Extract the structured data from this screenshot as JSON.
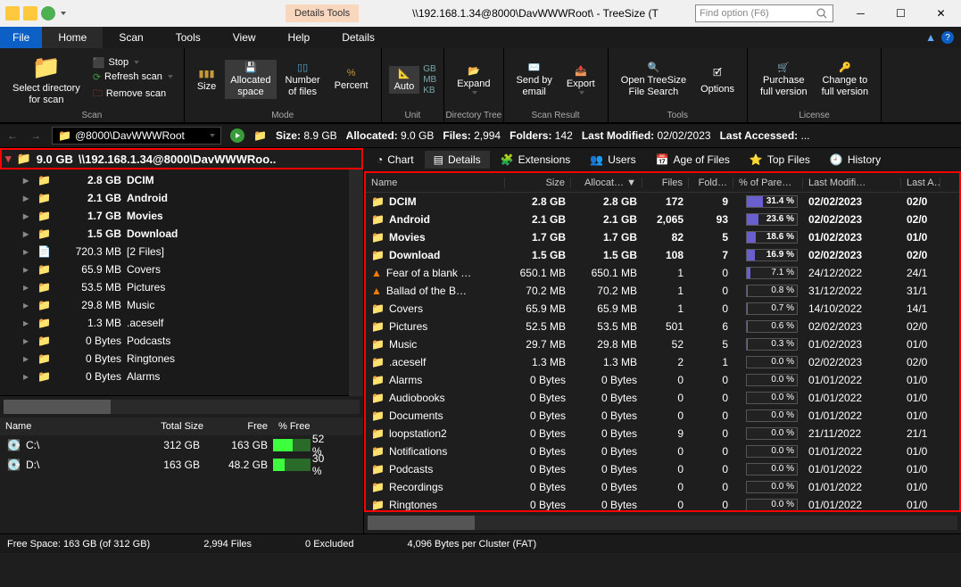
{
  "titlebar": {
    "details_tools": "Details Tools",
    "title": "\\\\192.168.1.34@8000\\DavWWWRoot\\ - TreeSize (T",
    "search_placeholder": "Find option (F6)"
  },
  "menu": {
    "file": "File",
    "home": "Home",
    "scan": "Scan",
    "tools": "Tools",
    "view": "View",
    "help": "Help",
    "details": "Details"
  },
  "ribbon": {
    "select_dir": "Select directory\nfor scan",
    "stop": "Stop",
    "refresh": "Refresh scan",
    "remove": "Remove scan",
    "scan_label": "Scan",
    "size": "Size",
    "allocated": "Allocated\nspace",
    "numfiles": "Number\nof files",
    "percent": "Percent",
    "mode_label": "Mode",
    "auto": "Auto",
    "gb": "GB",
    "mb": "MB",
    "kb": "KB",
    "unit_label": "Unit",
    "expand": "Expand",
    "dirtree_label": "Directory Tree",
    "sendby": "Send by\nemail",
    "export": "Export",
    "scanres_label": "Scan Result",
    "open_ts": "Open TreeSize\nFile Search",
    "options": "Options",
    "tools_label": "Tools",
    "purchase": "Purchase\nfull version",
    "change": "Change to\nfull version",
    "license_label": "License"
  },
  "pathbar": {
    "path": "@8000\\DavWWWRoot",
    "size_label": "Size:",
    "size_val": "8.9 GB",
    "alloc_label": "Allocated:",
    "alloc_val": "9.0 GB",
    "files_label": "Files:",
    "files_val": "2,994",
    "folders_label": "Folders:",
    "folders_val": "142",
    "lastmod_label": "Last Modified:",
    "lastmod_val": "02/02/2023",
    "lastacc_label": "Last Accessed:",
    "lastacc_val": "..."
  },
  "tree": {
    "header_size": "9.0 GB",
    "header_path": "\\\\192.168.1.34@8000\\DavWWWRoo..",
    "rows": [
      {
        "size": "2.8 GB",
        "name": "DCIM",
        "bold": true,
        "type": "folder"
      },
      {
        "size": "2.1 GB",
        "name": "Android",
        "bold": true,
        "type": "folder"
      },
      {
        "size": "1.7 GB",
        "name": "Movies",
        "bold": true,
        "type": "folder"
      },
      {
        "size": "1.5 GB",
        "name": "Download",
        "bold": true,
        "type": "folder"
      },
      {
        "size": "720.3 MB",
        "name": "[2 Files]",
        "type": "file"
      },
      {
        "size": "65.9 MB",
        "name": "Covers",
        "type": "folder"
      },
      {
        "size": "53.5 MB",
        "name": "Pictures",
        "type": "folder"
      },
      {
        "size": "29.8 MB",
        "name": "Music",
        "type": "folder"
      },
      {
        "size": "1.3 MB",
        "name": ".aceself",
        "type": "folder"
      },
      {
        "size": "0 Bytes",
        "name": "Podcasts",
        "type": "folder"
      },
      {
        "size": "0 Bytes",
        "name": "Ringtones",
        "type": "folder"
      },
      {
        "size": "0 Bytes",
        "name": "Alarms",
        "type": "folder"
      }
    ]
  },
  "drives": {
    "h_name": "Name",
    "h_total": "Total Size",
    "h_free": "Free",
    "h_pct": "% Free",
    "rows": [
      {
        "name": "C:\\",
        "total": "312 GB",
        "free": "163 GB",
        "pct": "52 %",
        "fill": 52
      },
      {
        "name": "D:\\",
        "total": "163 GB",
        "free": "48.2 GB",
        "pct": "30 %",
        "fill": 30
      }
    ]
  },
  "tabs": {
    "chart": "Chart",
    "details": "Details",
    "ext": "Extensions",
    "users": "Users",
    "age": "Age of Files",
    "top": "Top Files",
    "history": "History"
  },
  "grid": {
    "h_name": "Name",
    "h_size": "Size",
    "h_alloc": "Allocat…",
    "h_files": "Files",
    "h_fold": "Fold…",
    "h_pct": "% of Pare…",
    "h_mod": "Last Modifi…",
    "h_acc": "Last A…",
    "rows": [
      {
        "name": "DCIM",
        "size": "2.8 GB",
        "alloc": "2.8 GB",
        "files": "172",
        "fold": "9",
        "pct": "31.4 %",
        "pctv": 31.4,
        "mod": "02/02/2023",
        "acc": "02/0",
        "bold": true,
        "ico": "folder"
      },
      {
        "name": "Android",
        "size": "2.1 GB",
        "alloc": "2.1 GB",
        "files": "2,065",
        "fold": "93",
        "pct": "23.6 %",
        "pctv": 23.6,
        "mod": "02/02/2023",
        "acc": "02/0",
        "bold": true,
        "ico": "folder"
      },
      {
        "name": "Movies",
        "size": "1.7 GB",
        "alloc": "1.7 GB",
        "files": "82",
        "fold": "5",
        "pct": "18.6 %",
        "pctv": 18.6,
        "mod": "01/02/2023",
        "acc": "01/0",
        "bold": true,
        "ico": "folder"
      },
      {
        "name": "Download",
        "size": "1.5 GB",
        "alloc": "1.5 GB",
        "files": "108",
        "fold": "7",
        "pct": "16.9 %",
        "pctv": 16.9,
        "mod": "02/02/2023",
        "acc": "02/0",
        "bold": true,
        "ico": "folder"
      },
      {
        "name": "Fear of a blank …",
        "size": "650.1 MB",
        "alloc": "650.1 MB",
        "files": "1",
        "fold": "0",
        "pct": "7.1 %",
        "pctv": 7.1,
        "mod": "24/12/2022",
        "acc": "24/1",
        "ico": "vlc"
      },
      {
        "name": "Ballad of the B…",
        "size": "70.2 MB",
        "alloc": "70.2 MB",
        "files": "1",
        "fold": "0",
        "pct": "0.8 %",
        "pctv": 0.8,
        "mod": "31/12/2022",
        "acc": "31/1",
        "ico": "vlc"
      },
      {
        "name": "Covers",
        "size": "65.9 MB",
        "alloc": "65.9 MB",
        "files": "1",
        "fold": "0",
        "pct": "0.7 %",
        "pctv": 0.7,
        "mod": "14/10/2022",
        "acc": "14/1",
        "ico": "folder"
      },
      {
        "name": "Pictures",
        "size": "52.5 MB",
        "alloc": "53.5 MB",
        "files": "501",
        "fold": "6",
        "pct": "0.6 %",
        "pctv": 0.6,
        "mod": "02/02/2023",
        "acc": "02/0",
        "ico": "folder"
      },
      {
        "name": "Music",
        "size": "29.7 MB",
        "alloc": "29.8 MB",
        "files": "52",
        "fold": "5",
        "pct": "0.3 %",
        "pctv": 0.3,
        "mod": "01/02/2023",
        "acc": "01/0",
        "ico": "folder"
      },
      {
        "name": ".aceself",
        "size": "1.3 MB",
        "alloc": "1.3 MB",
        "files": "2",
        "fold": "1",
        "pct": "0.0 %",
        "pctv": 0,
        "mod": "02/02/2023",
        "acc": "02/0",
        "ico": "folder"
      },
      {
        "name": "Alarms",
        "size": "0 Bytes",
        "alloc": "0 Bytes",
        "files": "0",
        "fold": "0",
        "pct": "0.0 %",
        "pctv": 0,
        "mod": "01/01/2022",
        "acc": "01/0",
        "ico": "folder"
      },
      {
        "name": "Audiobooks",
        "size": "0 Bytes",
        "alloc": "0 Bytes",
        "files": "0",
        "fold": "0",
        "pct": "0.0 %",
        "pctv": 0,
        "mod": "01/01/2022",
        "acc": "01/0",
        "ico": "folder"
      },
      {
        "name": "Documents",
        "size": "0 Bytes",
        "alloc": "0 Bytes",
        "files": "0",
        "fold": "0",
        "pct": "0.0 %",
        "pctv": 0,
        "mod": "01/01/2022",
        "acc": "01/0",
        "ico": "folder"
      },
      {
        "name": "loopstation2",
        "size": "0 Bytes",
        "alloc": "0 Bytes",
        "files": "9",
        "fold": "0",
        "pct": "0.0 %",
        "pctv": 0,
        "mod": "21/11/2022",
        "acc": "21/1",
        "ico": "folder"
      },
      {
        "name": "Notifications",
        "size": "0 Bytes",
        "alloc": "0 Bytes",
        "files": "0",
        "fold": "0",
        "pct": "0.0 %",
        "pctv": 0,
        "mod": "01/01/2022",
        "acc": "01/0",
        "ico": "folder"
      },
      {
        "name": "Podcasts",
        "size": "0 Bytes",
        "alloc": "0 Bytes",
        "files": "0",
        "fold": "0",
        "pct": "0.0 %",
        "pctv": 0,
        "mod": "01/01/2022",
        "acc": "01/0",
        "ico": "folder"
      },
      {
        "name": "Recordings",
        "size": "0 Bytes",
        "alloc": "0 Bytes",
        "files": "0",
        "fold": "0",
        "pct": "0.0 %",
        "pctv": 0,
        "mod": "01/01/2022",
        "acc": "01/0",
        "ico": "folder"
      },
      {
        "name": "Ringtones",
        "size": "0 Bytes",
        "alloc": "0 Bytes",
        "files": "0",
        "fold": "0",
        "pct": "0.0 %",
        "pctv": 0,
        "mod": "01/01/2022",
        "acc": "01/0",
        "ico": "folder"
      }
    ]
  },
  "status": {
    "freespace": "Free Space: 163 GB  (of 312 GB)",
    "files": "2,994 Files",
    "excluded": "0 Excluded",
    "cluster": "4,096 Bytes per Cluster (FAT)"
  }
}
